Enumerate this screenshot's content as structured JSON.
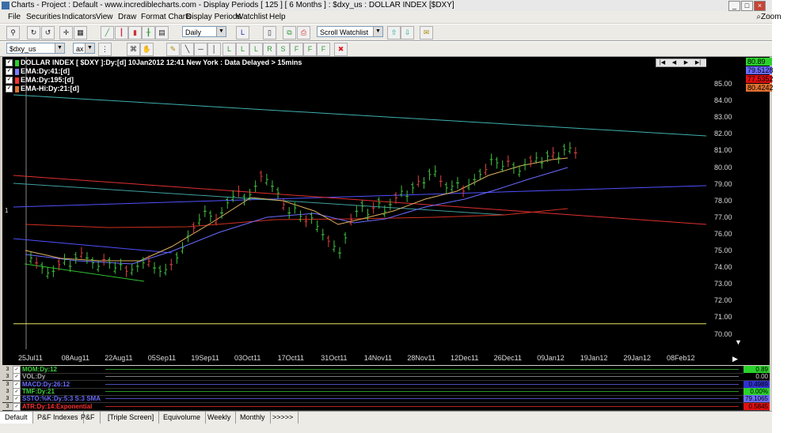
{
  "window": {
    "title": "Charts - Project : Default - www.incrediblecharts.com - Display Periods  [ 125 ]  [ 6 Months ]  :  $dxy_us : DOLLAR INDEX  [$DXY]"
  },
  "menu": [
    "File",
    "Securities",
    "Indicators",
    "View",
    "Draw",
    "Format Charts",
    "Display Periods",
    "Watchlist",
    "Help"
  ],
  "zoom_label": "Zoom",
  "toolbar": {
    "period": "Daily",
    "watchlist": "Scroll Watchlist"
  },
  "toolbar2": {
    "symbol": "$dxy_us",
    "ax": "ax"
  },
  "chart": {
    "header": "DOLLAR INDEX [ $DXY ]:Dy:[d]  10Jan2012 12:41 New York  : Data Delayed > 15mins",
    "legend": [
      {
        "label": "EMA:Dy:41:[d]",
        "color": "#7b7bff"
      },
      {
        "label": "EMA:Dy:195:[d]",
        "color": "#ff3030"
      },
      {
        "label": "EMA-Hi:Dy:21:[d]",
        "color": "#e07030"
      }
    ],
    "price_values": [
      {
        "value": "80.89",
        "bg": "#2bd12b",
        "fg": "#000"
      },
      {
        "value": "79.5128",
        "bg": "#6b6bff",
        "fg": "#000"
      },
      {
        "value": "77.5352",
        "bg": "#e01010",
        "fg": "#000"
      },
      {
        "value": "80.4242",
        "bg": "#e07030",
        "fg": "#000"
      }
    ],
    "y_ticks": [
      "85.00",
      "84.00",
      "83.00",
      "82.00",
      "81.00",
      "80.00",
      "79.00",
      "78.00",
      "77.00",
      "76.00",
      "75.00",
      "74.00",
      "73.00",
      "72.00",
      "71.00",
      "70.00"
    ],
    "x_ticks": [
      "25Jul11",
      "08Aug11",
      "22Aug11",
      "05Sep11",
      "19Sep11",
      "03Oct11",
      "17Oct11",
      "31Oct11",
      "14Nov11",
      "28Nov11",
      "12Dec11",
      "26Dec11",
      "09Jan12",
      "19Jan12",
      "29Jan12",
      "08Feb12"
    ],
    "left_marker": "1"
  },
  "subpanels": [
    {
      "num": "3",
      "label": "MOM:Dy:12",
      "color": "#3cd03c",
      "value": "0.89",
      "vbg": "#2bd12b"
    },
    {
      "num": "3",
      "label": "VOL:Dy",
      "color": "#aaa",
      "value": "0.00",
      "vbg": "#000"
    },
    {
      "num": "3",
      "label": "MACD:Dy:26:12",
      "color": "#6b6bff",
      "value": "0.4989",
      "vbg": "#3030d0"
    },
    {
      "num": "3",
      "label": "TMF:Dy:21",
      "color": "#3cd03c",
      "value": "0.00%",
      "vbg": "#2bd12b"
    },
    {
      "num": "3",
      "label": "SSTO:%K:Dy:5:3 S:3 SMA",
      "color": "#6b6bff",
      "value": "79.1065",
      "vbg": "#6b6bff"
    },
    {
      "num": "3",
      "label": "ATR:Dy:14:Exponential",
      "color": "#ff3030",
      "value": "0.5845",
      "vbg": "#e01010"
    }
  ],
  "tabs": [
    "Default",
    "P&F Indexes",
    "P&F",
    "[Triple Screen]",
    "Equivolume",
    "Weekly",
    "Monthly",
    ">>>>>"
  ]
}
